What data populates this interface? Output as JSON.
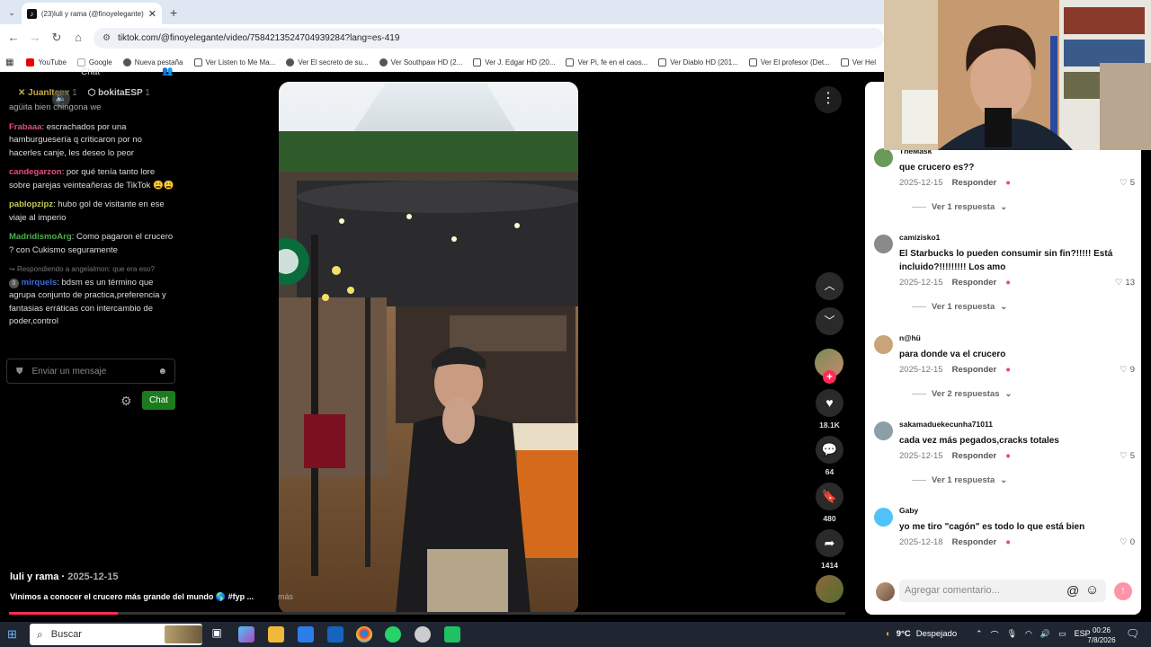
{
  "browser": {
    "tab_title": "(23)luli y rama (@finoyelegante)",
    "url": "tiktok.com/@finoyelegante/video/7584213524704939284?lang=es-419",
    "bookmarks": [
      "YouTube",
      "Google",
      "Nueva pestaña",
      "Ver Listen to Me Ma...",
      "Ver El secreto de su...",
      "Ver Southpaw HD (2...",
      "Ver J. Edgar HD (20...",
      "Ver Pi, fe en el caos...",
      "Ver Diablo HD (201...",
      "Ver El profesor (Det...",
      "Ver Hel"
    ]
  },
  "chat": {
    "title": "Chat",
    "top_users": [
      "JuanIteex",
      "bokitaESP"
    ],
    "top_counts": [
      "1",
      "1"
    ],
    "first_line": "agüita bien chingona we",
    "messages": [
      {
        "user": "Frabaaa",
        "color": "#e0507a",
        "text": ": escrachados por una hamburguesería q criticaron por no hacerles canje, les deseo lo peor"
      },
      {
        "user": "candegarzon",
        "color": "#e0507a",
        "text": ": por qué tenía tanto lore sobre parejas veinteañeras de TikTok 😩😩"
      },
      {
        "user": "pablopzipz",
        "color": "#c9c95a",
        "text": ": hubo gol de visitante en ese viaje al imperio"
      },
      {
        "user": "MadridismoArg",
        "color": "#4caf50",
        "text": ": Como pagaron el crucero ? con Cukismo seguramente"
      }
    ],
    "reply_hint": "Respondiendo a angelalmon: que era eso?",
    "last_message": {
      "user": "mirquels",
      "color": "#3d6bd6",
      "text": ": bdsm es un término que agrupa conjunto de practica,preferencia y fantasias erráticas con intercambio de poder,control"
    },
    "input_placeholder": "Enviar un mensaje",
    "send_label": "Chat"
  },
  "video": {
    "author": "luli y rama",
    "date": "2025-12-15",
    "description": "Vinimos a conocer el crucero más grande del mundo 🌎 #fyp ...",
    "more_label": "más",
    "progress_fraction": 0.13,
    "likes": "18.1K",
    "comments": "64",
    "saves": "480",
    "shares": "1414"
  },
  "comments": [
    {
      "user": "TheMask",
      "text": "que crucero es??",
      "date": "2025-12-15",
      "reply": "Responder",
      "likes": "5",
      "replies": "Ver 1 respuesta"
    },
    {
      "user": "camizisko1",
      "text": "El Starbucks lo pueden consumir sin fin?!!!!! Está incluido?!!!!!!!!! Los amo",
      "date": "2025-12-15",
      "reply": "Responder",
      "likes": "13",
      "replies": "Ver 1 respuesta"
    },
    {
      "user": "n@hü",
      "text": "para donde va el crucero",
      "date": "2025-12-15",
      "reply": "Responder",
      "likes": "9",
      "replies": "Ver 2 respuestas"
    },
    {
      "user": "sakamaduekecunha71011",
      "text": "cada vez más pegados,cracks totales",
      "date": "2025-12-15",
      "reply": "Responder",
      "likes": "5",
      "replies": "Ver 1 respuesta"
    },
    {
      "user": "Gaby",
      "text": "yo me tiro \"cagón\" es todo lo que está bien",
      "date": "2025-12-18",
      "reply": "Responder",
      "likes": "0",
      "replies": ""
    }
  ],
  "comment_input": {
    "placeholder": "Agregar comentario..."
  },
  "taskbar": {
    "search_placeholder": "Buscar",
    "weather": "9°C",
    "weather_desc": "Despejado",
    "lang": "ESP",
    "time": "00:26",
    "date": "7/8/2026"
  }
}
